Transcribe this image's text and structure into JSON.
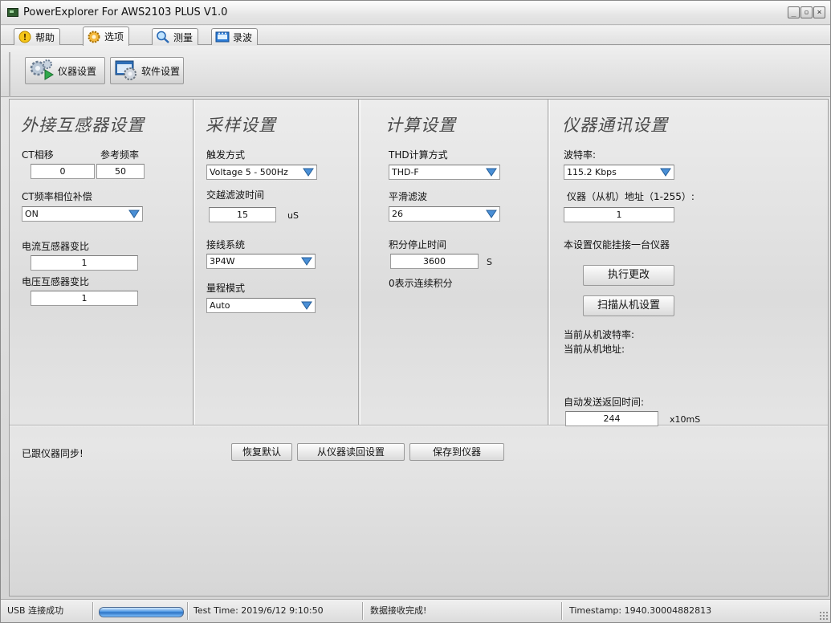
{
  "window": {
    "title": "PowerExplorer For AWS2103 PLUS V1.0",
    "controls": [
      "_",
      "▫",
      "×"
    ]
  },
  "tabs": [
    {
      "label": "帮助",
      "icon": "help-icon"
    },
    {
      "label": "选项",
      "icon": "options-icon",
      "active": true
    },
    {
      "label": "测量",
      "icon": "measure-icon"
    },
    {
      "label": "录波",
      "icon": "record-icon"
    }
  ],
  "toolbar": {
    "instrument_settings": "仪器设置",
    "software_settings": "软件设置"
  },
  "external_transformer": {
    "title": "外接互感器设置",
    "ct_phase_label": "CT相移",
    "ct_phase_value": "0",
    "ref_freq_label": "参考频率",
    "ref_freq_value": "50",
    "ct_comp_label": "CT频率相位补偿",
    "ct_comp_value": "ON",
    "current_ratio_label": "电流互感器变比",
    "current_ratio_value": "1",
    "voltage_ratio_label": "电压互感器变比",
    "voltage_ratio_value": "1"
  },
  "sampling": {
    "title": "采样设置",
    "trigger_label": "触发方式",
    "trigger_value": "Voltage 5 - 500Hz",
    "zero_cross_label": "交越滤波时间",
    "zero_cross_value": "15",
    "zero_cross_unit": "uS",
    "wiring_label": "接线系统",
    "wiring_value": "3P4W",
    "range_label": "量程模式",
    "range_value": "Auto"
  },
  "calculation": {
    "title": "计算设置",
    "thd_label": "THD计算方式",
    "thd_value": "THD-F",
    "smooth_label": "平滑滤波",
    "smooth_value": "26",
    "integral_label": "积分停止时间",
    "integral_value": "3600",
    "integral_unit": "S",
    "integral_note": "0表示连续积分"
  },
  "communication": {
    "title": "仪器通讯设置",
    "baud_label": "波特率:",
    "baud_value": "115.2 Kbps",
    "address_label": "仪器（从机）地址（1-255）:",
    "address_value": "1",
    "note": "本设置仅能挂接一台仪器",
    "apply_button": "执行更改",
    "scan_button": "扫描从机设置",
    "current_baud_label": "当前从机波特率:",
    "current_address_label": "当前从机地址:",
    "auto_send_label": "自动发送返回时间:",
    "auto_send_value": "244",
    "auto_send_unit": "x10mS"
  },
  "bottom": {
    "sync_status": "已跟仪器同步!",
    "restore_button": "恢复默认",
    "read_button": "从仪器读回设置",
    "save_button": "保存到仪器"
  },
  "statusbar": {
    "usb_status": "USB 连接成功",
    "progress": 1.0,
    "test_time": "Test Time: 2019/6/12 9:10:50",
    "data_status": "数据接收完成!",
    "timestamp": "Timestamp: 1940.30004882813"
  },
  "colors": {
    "progress_blue": "#3f8ee0",
    "section_title": "#4a4a4a",
    "arrow_blue": "#4a8fd6"
  }
}
